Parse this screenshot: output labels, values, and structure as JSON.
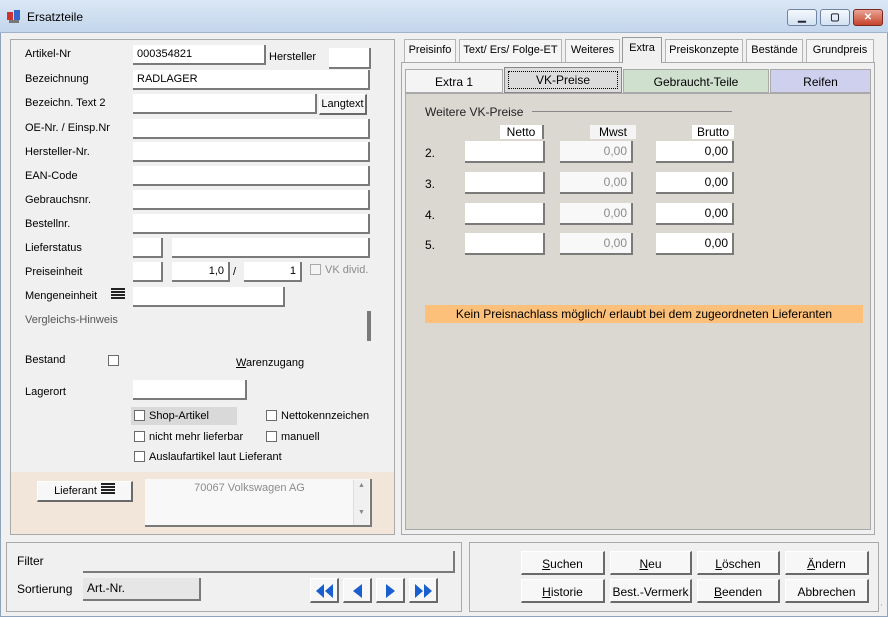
{
  "window": {
    "title": "Ersatzteile"
  },
  "form": {
    "artikel_nr": {
      "label": "Artikel-Nr",
      "value": "000354821"
    },
    "hersteller_btn": "Hersteller",
    "bezeichnung": {
      "label": "Bezeichnung",
      "value": "RADLAGER"
    },
    "bezeichn_text2": {
      "label": "Bezeichn. Text 2",
      "value": ""
    },
    "langtext_btn": "Langtext",
    "oe_nr": {
      "label": "OE-Nr. / Einsp.Nr",
      "value": ""
    },
    "hersteller_nr": {
      "label": "Hersteller-Nr.",
      "value": ""
    },
    "ean": {
      "label": "EAN-Code",
      "value": ""
    },
    "gebrauchsnr": {
      "label": "Gebrauchsnr.",
      "value": ""
    },
    "bestellnr": {
      "label": "Bestellnr.",
      "value": ""
    },
    "lieferstatus": {
      "label": "Lieferstatus",
      "value": ""
    },
    "preiseinheit": {
      "label": "Preiseinheit",
      "value1": "1,0",
      "sep": "/",
      "value2": "1",
      "vk_divid": "VK divid."
    },
    "mengeneinheit": {
      "label": "Mengeneinheit",
      "value": ""
    },
    "vergleichs": {
      "label": "Vergleichs-Hinweis"
    },
    "bestand": {
      "label": "Bestand"
    },
    "warenzugang": "Warenzugang",
    "lagerort": {
      "label": "Lagerort",
      "value": ""
    },
    "checkboxes": {
      "shop": "Shop-Artikel",
      "netto": "Nettokennzeichen",
      "nicht_mehr": "nicht mehr lieferbar",
      "manuell": "manuell",
      "auslauf": "Auslaufartikel laut Lieferant"
    },
    "lieferant_btn": "Lieferant",
    "lieferant_value": "70067 Volkswagen AG"
  },
  "tabs": [
    "Preisinfo",
    "Text/ Ers/ Folge-ET",
    "Weiteres",
    "Extra",
    "Preiskonzepte",
    "Bestände",
    "Grundpreis"
  ],
  "active_tab": "Extra",
  "subtabs": {
    "extra1": "Extra 1",
    "vk": "VK-Preise",
    "gebraucht": "Gebraucht-Teile",
    "reifen": "Reifen"
  },
  "vk": {
    "section_title": "Weitere VK-Preise",
    "col_netto": "Netto",
    "col_mwst": "Mwst",
    "col_brutto": "Brutto",
    "rows": [
      {
        "num": "2.",
        "netto": "",
        "mwst": "0,00",
        "brutto": "0,00"
      },
      {
        "num": "3.",
        "netto": "",
        "mwst": "0,00",
        "brutto": "0,00"
      },
      {
        "num": "4.",
        "netto": "",
        "mwst": "0,00",
        "brutto": "0,00"
      },
      {
        "num": "5.",
        "netto": "",
        "mwst": "0,00",
        "brutto": "0,00"
      }
    ],
    "warning": "Kein Preisnachlass möglich/ erlaubt bei dem zugeordneten Lieferanten"
  },
  "filter": {
    "label": "Filter",
    "value": ""
  },
  "sortierung": {
    "label": "Sortierung",
    "value": "Art.-Nr."
  },
  "actions": {
    "suchen": "Suchen",
    "neu": "Neu",
    "loeschen": "Löschen",
    "aendern": "Ändern",
    "historie": "Historie",
    "best_vermerk": "Best.-Vermerk",
    "beenden": "Beenden",
    "abbrechen": "Abbrechen"
  },
  "colors": {
    "warning_bg": "#fcc07a",
    "reifen_tab": "#cfcfee",
    "gebraucht_tab": "#cfe0cf",
    "nav_arrow": "#1a5fd0"
  }
}
